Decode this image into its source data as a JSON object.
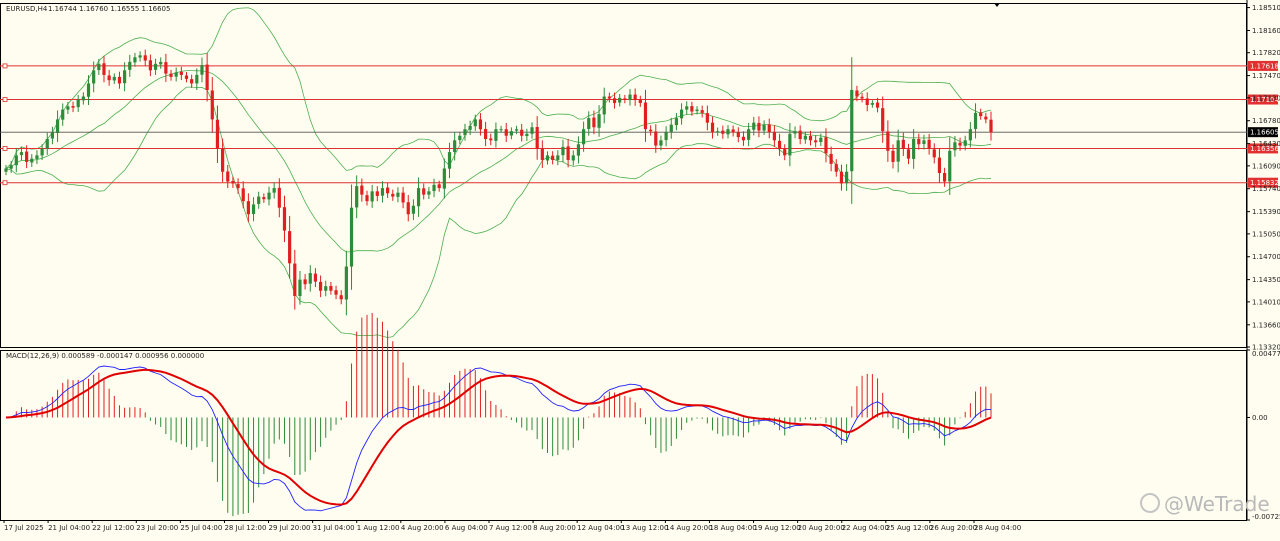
{
  "main_chart": {
    "symbol_label": "EURUSD,H4",
    "ohlc_label": "1.16744 1.16760 1.16555 1.16605"
  },
  "macd_panel": {
    "label": "MACD(12,26,9) 0.000589 -0.000147 0.000956 0.000000"
  },
  "watermark": {
    "text": "@WeTrade"
  },
  "colors": {
    "background": "#fffdf0",
    "bull": "#2e8b3a",
    "bear": "#e02020",
    "band": "#4caf50",
    "macd_line": "#2020ff",
    "signal_line": "#e00000",
    "level_line": "#e03030"
  },
  "chart_data": [
    {
      "type": "candlestick",
      "ylim": [
        1.1332,
        1.1858
      ],
      "y_ticks": [
        "1.18510",
        "1.18160",
        "1.17820",
        "1.17470",
        "1.17130",
        "1.16780",
        "1.16430",
        "1.16090",
        "1.15740",
        "1.15390",
        "1.15050",
        "1.14700",
        "1.14350",
        "1.14010",
        "1.13660",
        "1.13320"
      ],
      "x_tick_labels": [
        "17 Jul 2025",
        "21 Jul 04:00",
        "22 Jul 12:00",
        "23 Jul 20:00",
        "25 Jul 04:00",
        "28 Jul 12:00",
        "29 Jul 20:00",
        "31 Jul 04:00",
        "1 Aug 12:00",
        "4 Aug 20:00",
        "6 Aug 04:00",
        "7 Aug 12:00",
        "8 Aug 20:00",
        "12 Aug 04:00",
        "13 Aug 12:00",
        "14 Aug 20:00",
        "18 Aug 04:00",
        "19 Aug 12:00",
        "20 Aug 20:00",
        "22 Aug 04:00",
        "25 Aug 12:00",
        "26 Aug 20:00",
        "28 Aug 04:00"
      ],
      "horizontal_levels": [
        {
          "value": 1.17618,
          "label": "1.17618"
        },
        {
          "value": 1.17104,
          "label": "1.17104"
        },
        {
          "value": 1.16356,
          "label": "1.16356"
        },
        {
          "value": 1.15832,
          "label": "1.15832"
        }
      ],
      "current_price": {
        "value": 1.16605,
        "label": "1.16605"
      },
      "closes": [
        1.1605,
        1.161,
        1.1625,
        1.163,
        1.1615,
        1.162,
        1.1625,
        1.1635,
        1.165,
        1.166,
        1.168,
        1.1695,
        1.17,
        1.1698,
        1.171,
        1.1715,
        1.1735,
        1.1755,
        1.1765,
        1.1748,
        1.174,
        1.1745,
        1.1735,
        1.1755,
        1.1768,
        1.1775,
        1.1778,
        1.177,
        1.1755,
        1.1765,
        1.1768,
        1.175,
        1.1745,
        1.1752,
        1.1748,
        1.1742,
        1.1735,
        1.1748,
        1.1763,
        1.1725,
        1.168,
        1.1635,
        1.16,
        1.1585,
        1.1582,
        1.1575,
        1.1555,
        1.1535,
        1.155,
        1.1562,
        1.1558,
        1.1568,
        1.1575,
        1.1545,
        1.151,
        1.146,
        1.141,
        1.1435,
        1.1428,
        1.1445,
        1.1432,
        1.1418,
        1.1425,
        1.1418,
        1.1412,
        1.1405,
        1.1455,
        1.1545,
        1.1578,
        1.1565,
        1.1555,
        1.157,
        1.1563,
        1.1575,
        1.1567,
        1.1562,
        1.1568,
        1.1553,
        1.1535,
        1.1548,
        1.1575,
        1.1565,
        1.157,
        1.158,
        1.1575,
        1.1605,
        1.163,
        1.1648,
        1.1655,
        1.1665,
        1.167,
        1.168,
        1.1665,
        1.165,
        1.1648,
        1.1665,
        1.1665,
        1.1655,
        1.1662,
        1.1665,
        1.1655,
        1.1658,
        1.1668,
        1.1635,
        1.1618,
        1.1625,
        1.1618,
        1.1625,
        1.1638,
        1.1618,
        1.1625,
        1.1642,
        1.1665,
        1.1682,
        1.1668,
        1.1688,
        1.1715,
        1.1712,
        1.1705,
        1.1713,
        1.171,
        1.1718,
        1.171,
        1.1705,
        1.1665,
        1.1662,
        1.164,
        1.1648,
        1.166,
        1.1672,
        1.1682,
        1.1695,
        1.17,
        1.1692,
        1.1695,
        1.169,
        1.1675,
        1.166,
        1.1662,
        1.1658,
        1.1665,
        1.166,
        1.1653,
        1.1648,
        1.1665,
        1.1675,
        1.1663,
        1.1672,
        1.166,
        1.1648,
        1.1635,
        1.1625,
        1.1658,
        1.1662,
        1.165,
        1.1655,
        1.1648,
        1.1645,
        1.1652,
        1.1628,
        1.1612,
        1.16,
        1.1582,
        1.16,
        1.1725,
        1.1715,
        1.1712,
        1.1702,
        1.1705,
        1.1698,
        1.1662,
        1.1632,
        1.1615,
        1.1648,
        1.1635,
        1.162,
        1.165,
        1.1642,
        1.1648,
        1.1635,
        1.1622,
        1.1598,
        1.1585,
        1.1632,
        1.1645,
        1.164,
        1.1648,
        1.1665,
        1.169,
        1.1685,
        1.168,
        1.166
      ]
    },
    {
      "type": "macd",
      "ylim": [
        -0.007257,
        0.004774
      ],
      "y_ticks": [
        "0.004774",
        "0.00",
        "-0.007257"
      ],
      "fast": 12,
      "slow": 26,
      "signal": 9
    }
  ]
}
